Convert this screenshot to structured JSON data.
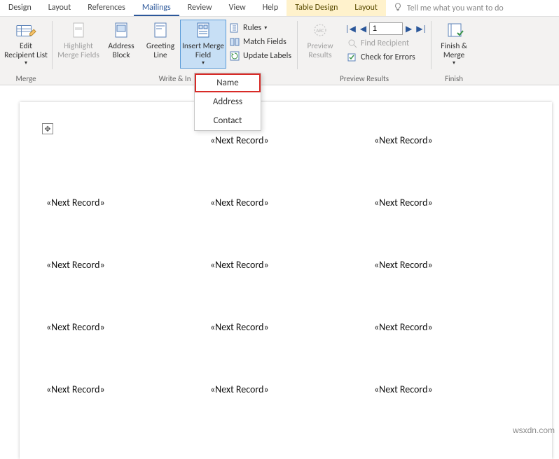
{
  "tabs": {
    "design": "Design",
    "layout1": "Layout",
    "references": "References",
    "mailings": "Mailings",
    "review": "Review",
    "view": "View",
    "help": "Help",
    "table_design": "Table Design",
    "layout2": "Layout",
    "tellme": "Tell me what you want to do"
  },
  "ribbon": {
    "edit_recipient": "Edit Recipient List",
    "highlight_merge": "Highlight Merge Fields",
    "address_block": "Address Block",
    "greeting_line": "Greeting Line",
    "insert_merge_field": "Insert Merge Field",
    "rules": "Rules",
    "match_fields": "Match Fields",
    "update_labels": "Update Labels",
    "preview_results": "Preview Results",
    "record_number": "1",
    "find_recipient": "Find Recipient",
    "check_errors": "Check for Errors",
    "finish_merge": "Finish & Merge",
    "group_merge": "Merge",
    "group_write_insert": "Write & In",
    "group_preview": "Preview Results",
    "group_finish": "Finish"
  },
  "menu": {
    "name": "Name",
    "address": "Address",
    "contact": "Contact"
  },
  "doc": {
    "next_record": "«Next Record»"
  },
  "watermark": "wsxdn.com"
}
